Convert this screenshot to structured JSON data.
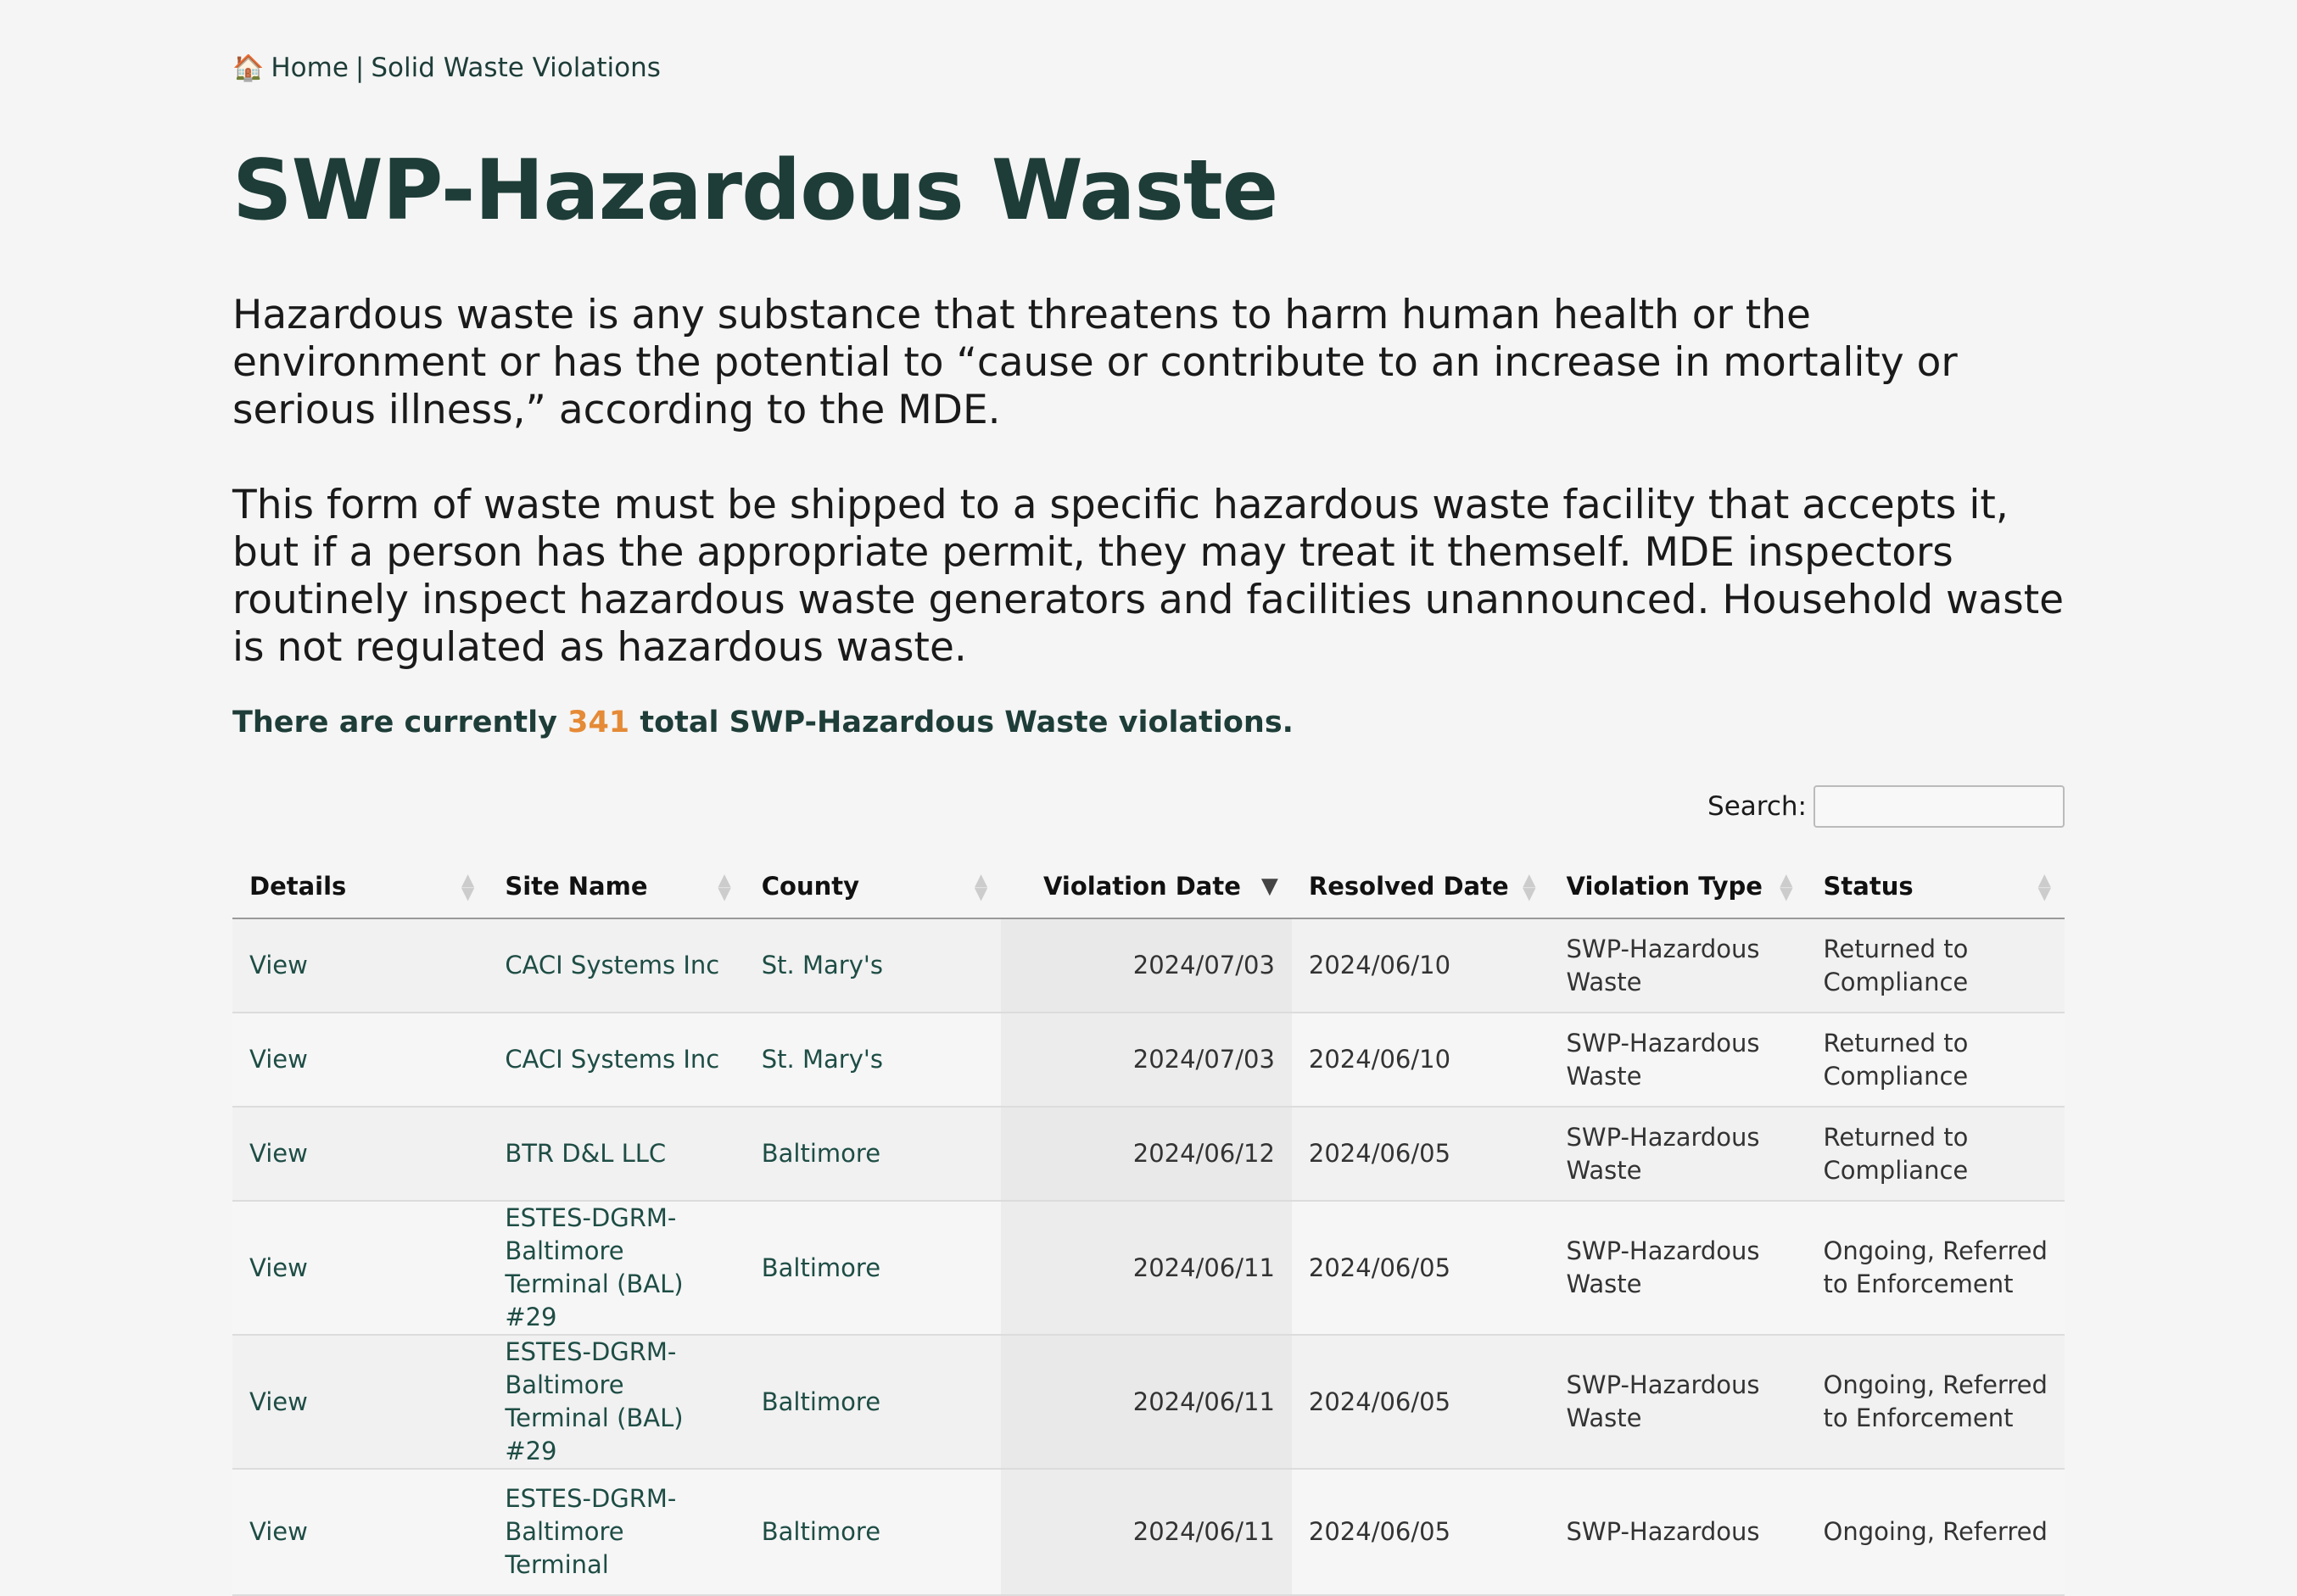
{
  "breadcrumb": {
    "home": "Home",
    "separator": "|",
    "current": "Solid Waste Violations"
  },
  "title": "SWP-Hazardous Waste",
  "paragraphs": [
    "Hazardous waste is any substance that threatens to harm human health or the environment or has the potential to “cause or contribute to an increase in mortality or serious illness,” according to the MDE.",
    "This form of waste must be shipped to a specific hazardous waste facility that accepts it, but if a person has the appropriate permit, they may treat it themself. MDE inspectors routinely inspect hazardous waste generators and facilities unannounced. Household waste is not regulated as hazardous waste."
  ],
  "summary": {
    "prefix": "There are currently",
    "count": "341",
    "suffix": "total SWP-Hazardous Waste violations."
  },
  "search": {
    "label": "Search:",
    "value": ""
  },
  "table": {
    "headers": [
      "Details",
      "Site Name",
      "County",
      "Violation Date",
      "Resolved Date",
      "Violation Type",
      "Status"
    ],
    "sorted_column": "Violation Date",
    "rows": [
      [
        "View",
        "CACI Systems Inc",
        "St. Mary's",
        "2024/07/03",
        "2024/06/10",
        "SWP-Hazardous Waste",
        "Returned to Compliance"
      ],
      [
        "View",
        "CACI Systems Inc",
        "St. Mary's",
        "2024/07/03",
        "2024/06/10",
        "SWP-Hazardous Waste",
        "Returned to Compliance"
      ],
      [
        "View",
        "BTR D&L LLC",
        "Baltimore",
        "2024/06/12",
        "2024/06/05",
        "SWP-Hazardous Waste",
        "Returned to Compliance"
      ],
      [
        "View",
        "ESTES-DGRM-Baltimore Terminal (BAL) #29",
        "Baltimore",
        "2024/06/11",
        "2024/06/05",
        "SWP-Hazardous Waste",
        "Ongoing, Referred to Enforcement"
      ],
      [
        "View",
        "ESTES-DGRM-Baltimore Terminal (BAL) #29",
        "Baltimore",
        "2024/06/11",
        "2024/06/05",
        "SWP-Hazardous Waste",
        "Ongoing, Referred to Enforcement"
      ],
      [
        "View",
        "ESTES-DGRM-Baltimore Terminal",
        "Baltimore",
        "2024/06/11",
        "2024/06/05",
        "SWP-Hazardous",
        "Ongoing, Referred"
      ]
    ]
  },
  "colors": {
    "heading": "#1e3d38",
    "accent": "#e58a36",
    "link": "#1e4d45"
  },
  "icons": {
    "home": "house-icon"
  }
}
